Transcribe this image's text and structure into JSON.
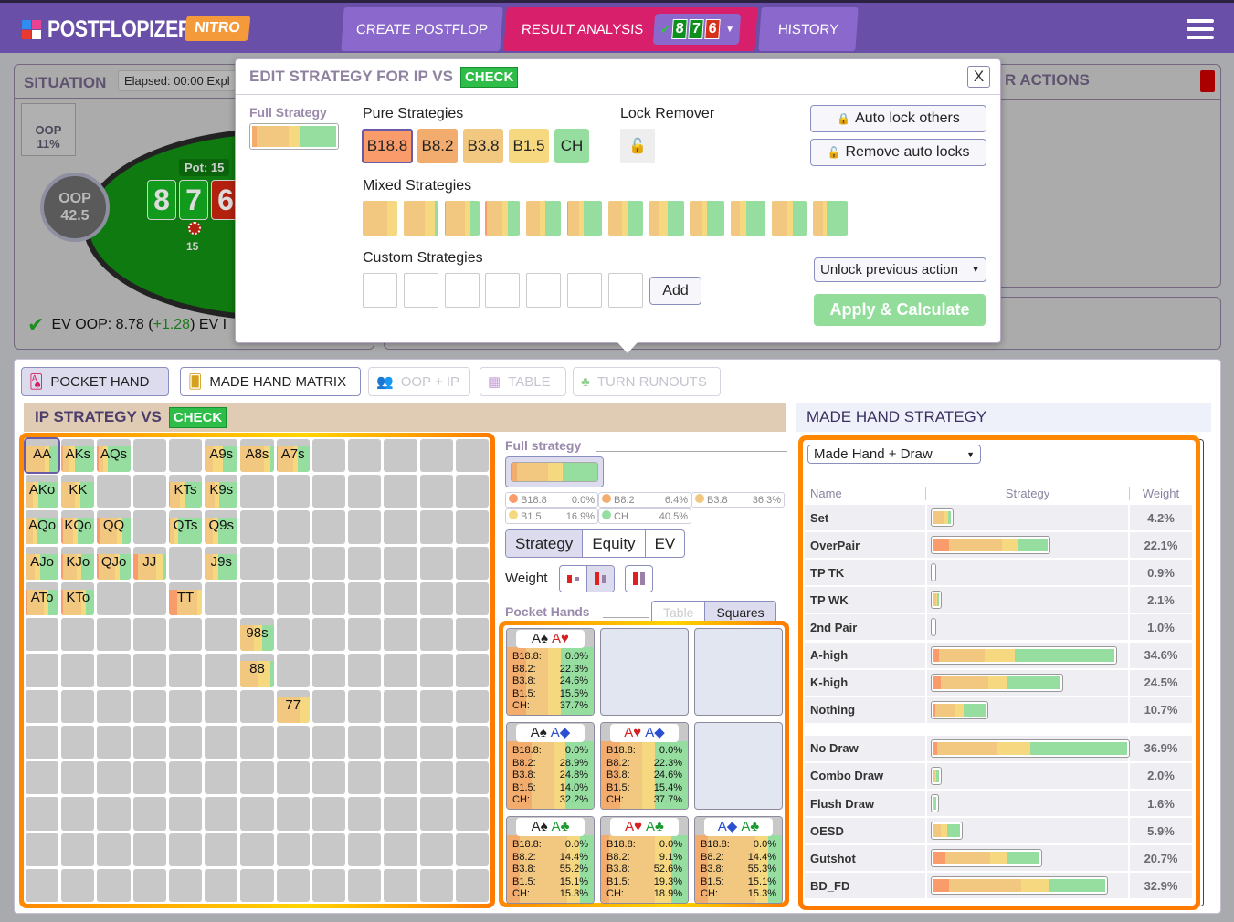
{
  "app": {
    "name": "POSTFLOPIZER",
    "edition": "NITRO"
  },
  "nav": {
    "tabs": [
      {
        "label": "CREATE POSTFLOP",
        "active": false
      },
      {
        "label": "RESULT ANALYSIS",
        "active": true
      },
      {
        "label": "HISTORY",
        "active": false
      }
    ],
    "board": [
      "8",
      "7",
      "6"
    ],
    "board_colors": [
      "#0e8f1e",
      "#0e8f1e",
      "#d4321a"
    ]
  },
  "colors": {
    "B18.8": "#f99b6b",
    "B8.2": "#f2ad6e",
    "B3.8": "#f2c77f",
    "B1.5": "#f6d881",
    "CH": "#96dea0",
    "accent": "#6a4fa8",
    "active_tab": "#d81f6b",
    "check_badge": "#2ebd48",
    "highlight": "#ff8800"
  },
  "situation": {
    "title": "SITUATION",
    "elapsed": "Elapsed: 00:00  Expl",
    "oop_range_label": "OOP",
    "oop_range_pct": "11%",
    "seat_name": "OOP",
    "seat_stack": "42.5",
    "pot": "Pot: 15",
    "chip_value": "15",
    "ev_text": "EV OOP: 8.78 (",
    "ev_delta": "+1.28",
    "ev_suffix": ") EV I",
    "right_panel_title": "R ACTIONS"
  },
  "modal": {
    "title": "EDIT STRATEGY FOR IP VS",
    "badge": "CHECK",
    "close": "X",
    "full_strategy_label": "Full Strategy",
    "full_strategy": [
      2,
      15,
      5,
      17
    ],
    "pure_label": "Pure Strategies",
    "pure": [
      "B18.8",
      "B8.2",
      "B3.8",
      "B1.5",
      "CH"
    ],
    "lock_remover_label": "Lock Remover",
    "auto_lock": "Auto lock others",
    "remove_auto": "Remove auto locks",
    "mixed_label": "Mixed Strategies",
    "mixed": [
      [
        0,
        0,
        70,
        30,
        0
      ],
      [
        0,
        0,
        60,
        30,
        10
      ],
      [
        4,
        0,
        55,
        15,
        26
      ],
      [
        4,
        0,
        45,
        15,
        36
      ],
      [
        0,
        0,
        40,
        15,
        45
      ],
      [
        3,
        0,
        30,
        15,
        52
      ],
      [
        0,
        0,
        40,
        15,
        45
      ],
      [
        0,
        0,
        30,
        25,
        45
      ],
      [
        0,
        0,
        35,
        15,
        50
      ],
      [
        0,
        0,
        25,
        20,
        55
      ],
      [
        0,
        0,
        45,
        15,
        40
      ],
      [
        0,
        0,
        30,
        10,
        60
      ]
    ],
    "custom_label": "Custom Strategies",
    "custom_count": 7,
    "add": "Add",
    "unlock_select": "Unlock previous action",
    "apply": "Apply & Calculate"
  },
  "view_tabs": [
    {
      "label": "POCKET HAND",
      "state": "active"
    },
    {
      "label": "MADE HAND MATRIX",
      "state": "normal"
    },
    {
      "label": "OOP + IP",
      "state": "disabled"
    },
    {
      "label": "TABLE",
      "state": "disabled"
    },
    {
      "label": "TURN RUNOUTS",
      "state": "disabled"
    }
  ],
  "ip_strategy": {
    "title": "IP STRATEGY VS",
    "badge": "CHECK"
  },
  "grid": {
    "cells": [
      {
        "r": 0,
        "c": 0,
        "label": "AA",
        "mix": [
          3,
          0,
          55,
          15,
          27
        ],
        "sel": true
      },
      {
        "r": 0,
        "c": 1,
        "label": "AKs",
        "mix": [
          0,
          5,
          20,
          15,
          60
        ]
      },
      {
        "r": 0,
        "c": 2,
        "label": "AQs",
        "mix": [
          3,
          0,
          15,
          15,
          67
        ]
      },
      {
        "r": 0,
        "c": 5,
        "label": "A9s",
        "mix": [
          0,
          0,
          25,
          30,
          45
        ]
      },
      {
        "r": 0,
        "c": 6,
        "label": "A8s",
        "mix": [
          0,
          0,
          70,
          20,
          10
        ]
      },
      {
        "r": 0,
        "c": 7,
        "label": "A7s",
        "mix": [
          5,
          0,
          45,
          15,
          35
        ]
      },
      {
        "r": 1,
        "c": 0,
        "label": "AKo",
        "mix": [
          3,
          0,
          20,
          15,
          62
        ]
      },
      {
        "r": 1,
        "c": 1,
        "label": "KK",
        "mix": [
          0,
          0,
          40,
          18,
          42
        ]
      },
      {
        "r": 1,
        "c": 4,
        "label": "KTs",
        "mix": [
          3,
          0,
          30,
          15,
          52
        ]
      },
      {
        "r": 1,
        "c": 5,
        "label": "K9s",
        "mix": [
          0,
          0,
          30,
          15,
          55
        ]
      },
      {
        "r": 2,
        "c": 0,
        "label": "AQo",
        "mix": [
          3,
          0,
          20,
          10,
          67
        ]
      },
      {
        "r": 2,
        "c": 1,
        "label": "KQo",
        "mix": [
          4,
          0,
          30,
          15,
          51
        ]
      },
      {
        "r": 2,
        "c": 2,
        "label": "QQ",
        "mix": [
          10,
          0,
          50,
          15,
          25
        ]
      },
      {
        "r": 2,
        "c": 4,
        "label": "QTs",
        "mix": [
          3,
          0,
          10,
          15,
          72
        ]
      },
      {
        "r": 2,
        "c": 5,
        "label": "Q9s",
        "mix": [
          0,
          0,
          25,
          15,
          60
        ]
      },
      {
        "r": 3,
        "c": 0,
        "label": "AJo",
        "mix": [
          3,
          0,
          25,
          15,
          57
        ]
      },
      {
        "r": 3,
        "c": 1,
        "label": "KJo",
        "mix": [
          6,
          0,
          40,
          15,
          39
        ]
      },
      {
        "r": 3,
        "c": 2,
        "label": "QJo",
        "mix": [
          3,
          0,
          50,
          15,
          32
        ]
      },
      {
        "r": 3,
        "c": 3,
        "label": "JJ",
        "mix": [
          15,
          0,
          55,
          20,
          10
        ]
      },
      {
        "r": 3,
        "c": 5,
        "label": "J9s",
        "mix": [
          0,
          0,
          25,
          15,
          60
        ]
      },
      {
        "r": 4,
        "c": 0,
        "label": "ATo",
        "mix": [
          5,
          0,
          50,
          15,
          30
        ]
      },
      {
        "r": 4,
        "c": 1,
        "label": "KTo",
        "mix": [
          5,
          0,
          55,
          15,
          25
        ]
      },
      {
        "r": 4,
        "c": 4,
        "label": "TT",
        "mix": [
          25,
          0,
          60,
          15,
          0
        ]
      },
      {
        "r": 5,
        "c": 6,
        "label": "98s",
        "mix": [
          0,
          0,
          40,
          25,
          35
        ]
      },
      {
        "r": 6,
        "c": 6,
        "label": "88",
        "mix": [
          0,
          0,
          55,
          35,
          10
        ]
      },
      {
        "r": 7,
        "c": 7,
        "label": "77",
        "mix": [
          0,
          0,
          70,
          30,
          0
        ]
      }
    ]
  },
  "full_strategy_panel": {
    "title": "Full strategy",
    "bar": [
      6.4,
      36.3,
      16.9,
      40.5
    ],
    "legend": [
      {
        "name": "B18.8",
        "value": "0.0%"
      },
      {
        "name": "B8.2",
        "value": "6.4%"
      },
      {
        "name": "B3.8",
        "value": "36.3%"
      },
      {
        "name": "B1.5",
        "value": "16.9%"
      },
      {
        "name": "CH",
        "value": "40.5%"
      }
    ],
    "modes": [
      "Strategy",
      "Equity",
      "EV"
    ],
    "weight_label": "Weight",
    "pocket_hands_label": "Pocket Hands",
    "views": [
      "Table",
      "Squares"
    ]
  },
  "combos": [
    {
      "pos": 0,
      "cards": [
        {
          "t": "A♠",
          "c": "#222"
        },
        {
          "t": "A♥",
          "c": "#d42020"
        }
      ],
      "vals": [
        "0.0%",
        "22.3%",
        "24.6%",
        "15.5%",
        "37.7%"
      ]
    },
    {
      "pos": 1,
      "empty": true
    },
    {
      "pos": 2,
      "empty": true
    },
    {
      "pos": 3,
      "cards": [
        {
          "t": "A♠",
          "c": "#222"
        },
        {
          "t": "A◆",
          "c": "#2a4fd0"
        }
      ],
      "vals": [
        "0.0%",
        "28.9%",
        "24.8%",
        "14.0%",
        "32.2%"
      ]
    },
    {
      "pos": 4,
      "cards": [
        {
          "t": "A♥",
          "c": "#d42020"
        },
        {
          "t": "A◆",
          "c": "#2a4fd0"
        }
      ],
      "vals": [
        "0.0%",
        "22.3%",
        "24.6%",
        "15.4%",
        "37.7%"
      ]
    },
    {
      "pos": 5,
      "empty": true
    },
    {
      "pos": 6,
      "cards": [
        {
          "t": "A♠",
          "c": "#222"
        },
        {
          "t": "A♣",
          "c": "#1a9a30"
        }
      ],
      "vals": [
        "0.0%",
        "14.4%",
        "55.2%",
        "15.1%",
        "15.3%"
      ]
    },
    {
      "pos": 7,
      "cards": [
        {
          "t": "A♥",
          "c": "#d42020"
        },
        {
          "t": "A♣",
          "c": "#1a9a30"
        }
      ],
      "vals": [
        "0.0%",
        "9.1%",
        "52.6%",
        "19.3%",
        "18.9%"
      ]
    },
    {
      "pos": 8,
      "cards": [
        {
          "t": "A◆",
          "c": "#2a4fd0"
        },
        {
          "t": "A♣",
          "c": "#1a9a30"
        }
      ],
      "vals": [
        "0.0%",
        "14.4%",
        "55.3%",
        "15.1%",
        "15.3%"
      ]
    }
  ],
  "combo_labels": [
    "B18.8:",
    "B8.2:",
    "B3.8:",
    "B1.5:",
    "CH:"
  ],
  "made_hand": {
    "title": "MADE HAND STRATEGY",
    "select": "Made Hand + Draw",
    "headers": [
      "Name",
      "Strategy",
      "Weight"
    ],
    "rows": [
      {
        "name": "Set",
        "weight": "4.2%",
        "w": 4.2,
        "mix": [
          0,
          0,
          60,
          25,
          15
        ]
      },
      {
        "name": "OverPair",
        "weight": "22.1%",
        "w": 22.1,
        "mix": [
          14,
          0,
          46,
          15,
          25
        ]
      },
      {
        "name": "TP TK",
        "weight": "0.9%",
        "w": 0.9,
        "mix": [
          0,
          0,
          100,
          0,
          0
        ]
      },
      {
        "name": "TP WK",
        "weight": "2.1%",
        "w": 2.1,
        "mix": [
          0,
          0,
          45,
          25,
          30
        ]
      },
      {
        "name": "2nd Pair",
        "weight": "1.0%",
        "w": 1.0,
        "mix": [
          0,
          0,
          100,
          0,
          0
        ]
      },
      {
        "name": "A-high",
        "weight": "34.6%",
        "w": 34.6,
        "mix": [
          3,
          0,
          25,
          17,
          55
        ]
      },
      {
        "name": "K-high",
        "weight": "24.5%",
        "w": 24.5,
        "mix": [
          6,
          0,
          37,
          15,
          42
        ]
      },
      {
        "name": "Nothing",
        "weight": "10.7%",
        "w": 10.7,
        "mix": [
          4,
          0,
          38,
          15,
          43
        ]
      },
      {
        "name": "No Draw",
        "weight": "36.9%",
        "w": 36.9,
        "mix": [
          2,
          0,
          31,
          17,
          50
        ]
      },
      {
        "name": "Combo Draw",
        "weight": "2.0%",
        "w": 2.0,
        "mix": [
          0,
          0,
          30,
          30,
          40
        ]
      },
      {
        "name": "Flush Draw",
        "weight": "1.6%",
        "w": 1.6,
        "mix": [
          0,
          0,
          20,
          10,
          70
        ]
      },
      {
        "name": "OESD",
        "weight": "5.9%",
        "w": 5.9,
        "mix": [
          0,
          0,
          28,
          25,
          47
        ]
      },
      {
        "name": "Gutshot",
        "weight": "20.7%",
        "w": 20.7,
        "mix": [
          11,
          0,
          42,
          16,
          31
        ]
      },
      {
        "name": "BD_FD",
        "weight": "32.9%",
        "w": 32.9,
        "mix": [
          9,
          0,
          42,
          16,
          33
        ]
      }
    ]
  }
}
